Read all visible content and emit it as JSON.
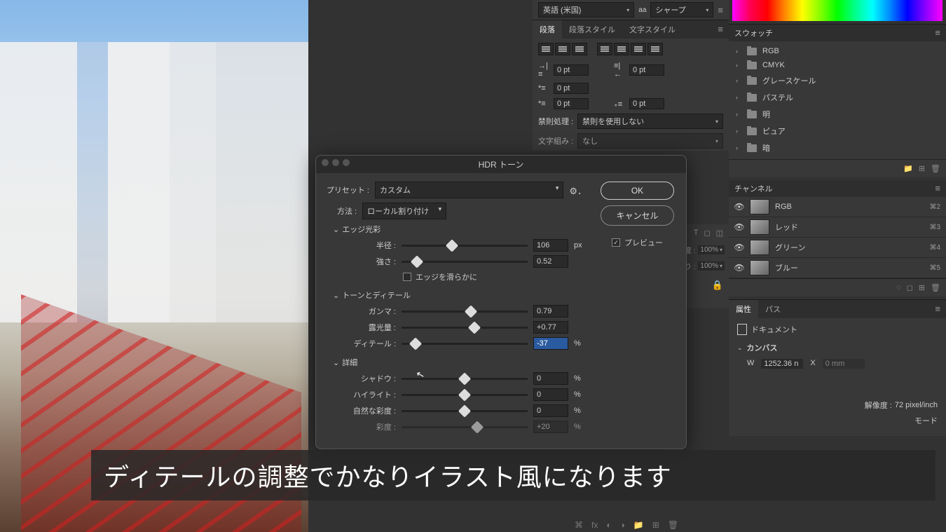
{
  "character_panel": {
    "language": "英語 (米国)",
    "antialias_label": "aa",
    "antialias": "シャープ",
    "tabs": [
      "段落",
      "段落スタイル",
      "文字スタイル"
    ],
    "indent_values": [
      "0 pt",
      "0 pt",
      "0 pt",
      "0 pt",
      "0 pt"
    ],
    "kinsoku_label": "禁則処理 :",
    "kinsoku_value": "禁則を使用しない",
    "mojikumi_label": "文字組み :",
    "mojikumi_value": "なし"
  },
  "hdr": {
    "title": "HDR トーン",
    "preset_label": "プリセット :",
    "preset_value": "カスタム",
    "method_label": "方法 :",
    "method_value": "ローカル割り付け",
    "ok": "OK",
    "cancel": "キャンセル",
    "preview": "プレビュー",
    "sections": {
      "edge": {
        "title": "エッジ光彩",
        "radius_label": "半径 :",
        "radius_value": "106",
        "radius_unit": "px",
        "strength_label": "強さ :",
        "strength_value": "0.52",
        "smooth_label": "エッジを滑らかに"
      },
      "tone": {
        "title": "トーンとディテール",
        "gamma_label": "ガンマ :",
        "gamma_value": "0.79",
        "exposure_label": "露光量 :",
        "exposure_value": "+0.77",
        "detail_label": "ディテール :",
        "detail_value": "-37",
        "detail_unit": "%"
      },
      "advanced": {
        "title": "詳細",
        "shadow_label": "シャドウ :",
        "shadow_value": "0",
        "highlight_label": "ハイライト :",
        "highlight_value": "0",
        "vibrance_label": "自然な彩度 :",
        "vibrance_value": "0",
        "saturation_label": "彩度 :",
        "saturation_value": "+20",
        "unit": "%"
      }
    }
  },
  "swatches": {
    "title": "スウォッチ",
    "groups": [
      "RGB",
      "CMYK",
      "グレースケール",
      "パステル",
      "明",
      "ピュア",
      "暗"
    ]
  },
  "channels": {
    "title": "チャンネル",
    "items": [
      {
        "name": "RGB",
        "shortcut": "⌘2"
      },
      {
        "name": "レッド",
        "shortcut": "⌘3"
      },
      {
        "name": "グリーン",
        "shortcut": "⌘4"
      },
      {
        "name": "ブルー",
        "shortcut": "⌘5"
      }
    ]
  },
  "properties": {
    "tabs": [
      "属性",
      "パス"
    ],
    "document": "ドキュメント",
    "canvas": "カンバス",
    "w_label": "W",
    "w_value": "1252.36 n",
    "x_label": "X",
    "x_value": "0 mm",
    "resolution_label": "解像度 :",
    "resolution_value": "72 pixel/inch",
    "mode_label": "モード"
  },
  "layers": {
    "opacity_label": "不透明度 :",
    "opacity_value": "100%",
    "fill_label": "塗り :",
    "fill_value": "100%"
  },
  "subtitle": "ディテールの調整でかなりイラスト風になります"
}
